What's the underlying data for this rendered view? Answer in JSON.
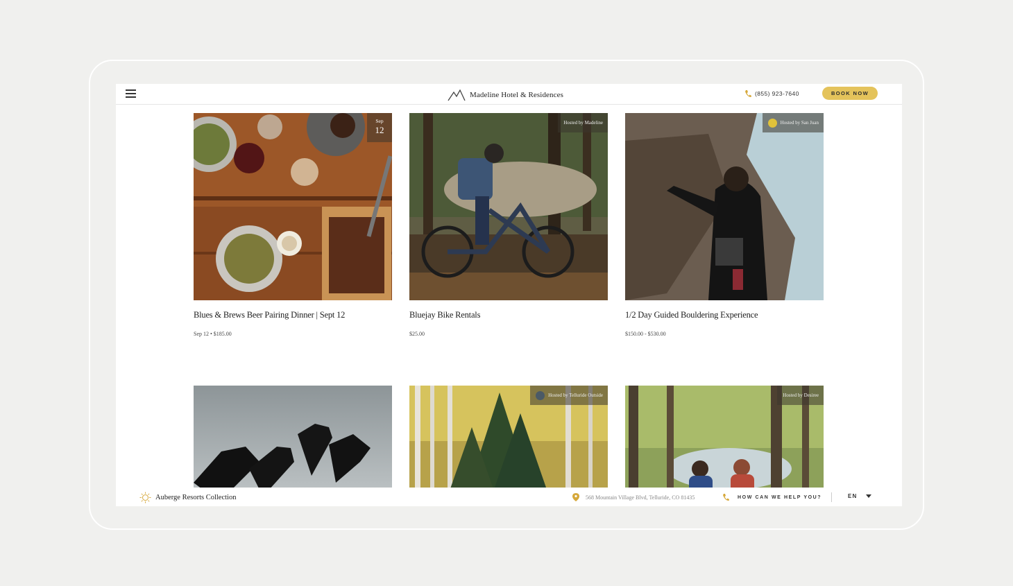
{
  "header": {
    "brand_name": "Madeline Hotel & Residences",
    "phone": "(855) 923-7640",
    "book_label": "BOOK NOW"
  },
  "cards": [
    {
      "title": "Blues & Brews Beer Pairing Dinner | Sept 12",
      "meta": "Sep 12 • $185.00",
      "date_month": "Sep",
      "date_day": "12",
      "image": "dinner-table-photo"
    },
    {
      "title": "Bluejay Bike Rentals",
      "meta": "$25.00",
      "hosted": "Hosted by Madeline",
      "image": "bike-rider-photo"
    },
    {
      "title": "1/2 Day Guided Bouldering Experience",
      "meta": "$150.00 - $530.00",
      "hosted": "Hosted by San Juan",
      "image": "rock-climber-photo"
    },
    {
      "image": "golf-clubs-photo"
    },
    {
      "hosted": "Hosted by Telluride Outside",
      "image": "aspen-forest-photo"
    },
    {
      "hosted": "Hosted by Desiree",
      "image": "hikers-photo"
    }
  ],
  "footer": {
    "brand": "Auberge Resorts Collection",
    "address": "568 Mountain Village Blvd, Telluride, CO 81435",
    "help": "HOW CAN WE HELP YOU?",
    "language": "EN"
  },
  "colors": {
    "accent": "#e4c35b",
    "background": "#f0f0ee"
  }
}
